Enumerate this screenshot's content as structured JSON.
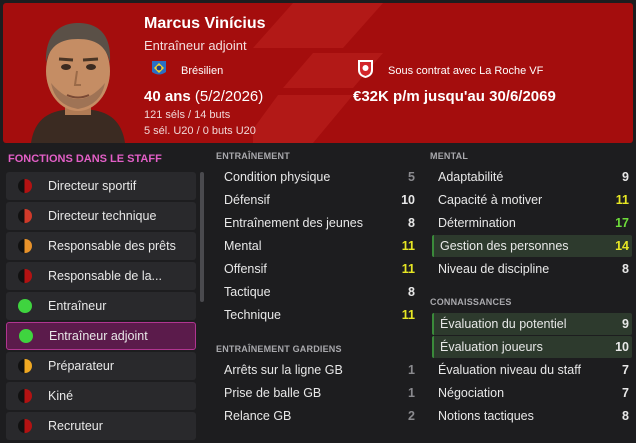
{
  "person": {
    "name": "Marcus Vinícius",
    "role": "Entraîneur adjoint",
    "nationality": "Brésilien",
    "age": "40 ans",
    "dob": "(5/2/2026)",
    "caps": "121 séls / 14 buts",
    "u20": "5 sél. U20 / 0 buts U20",
    "club": "Sous contrat avec La Roche VF",
    "contract": "€32K p/m jusqu'au 30/6/2069"
  },
  "colors": {
    "header": "#a40d0d",
    "roles_title": "#e35fc7",
    "active_role": "#5b1b4b",
    "highlight_row": "#2d3a2d"
  },
  "staff_roles": {
    "title": "FONCTIONS DANS LE STAFF",
    "items": [
      {
        "label": "Directeur sportif",
        "color": "#b31212",
        "half": true
      },
      {
        "label": "Directeur technique",
        "color": "#d03a2a",
        "half": true
      },
      {
        "label": "Responsable des prêts",
        "color": "#e8922a",
        "half": true
      },
      {
        "label": "Responsable de la...",
        "color": "#b31212",
        "half": true
      },
      {
        "label": "Entraîneur",
        "color": "#3fd43f",
        "half": false
      },
      {
        "label": "Entraîneur adjoint",
        "color": "#3fd43f",
        "half": false,
        "active": true
      },
      {
        "label": "Préparateur",
        "color": "#f0a822",
        "half": true
      },
      {
        "label": "Kiné",
        "color": "#b31212",
        "half": true
      },
      {
        "label": "Recruteur",
        "color": "#b31212",
        "half": true
      }
    ]
  },
  "training": {
    "title": "ENTRAÎNEMENT",
    "rows": [
      {
        "name": "Condition physique",
        "value": "5",
        "level": "low"
      },
      {
        "name": "Défensif",
        "value": "10",
        "level": "mid"
      },
      {
        "name": "Entraînement des jeunes",
        "value": "8",
        "level": "mid"
      },
      {
        "name": "Mental",
        "value": "11",
        "level": "yel"
      },
      {
        "name": "Offensif",
        "value": "11",
        "level": "yel"
      },
      {
        "name": "Tactique",
        "value": "8",
        "level": "mid"
      },
      {
        "name": "Technique",
        "value": "11",
        "level": "yel"
      }
    ]
  },
  "goalkeeping": {
    "title": "ENTRAÎNEMENT GARDIENS",
    "rows": [
      {
        "name": "Arrêts sur la ligne GB",
        "value": "1",
        "level": "low"
      },
      {
        "name": "Prise de balle GB",
        "value": "1",
        "level": "low"
      },
      {
        "name": "Relance GB",
        "value": "2",
        "level": "low"
      }
    ]
  },
  "mental": {
    "title": "MENTAL",
    "rows": [
      {
        "name": "Adaptabilité",
        "value": "9",
        "level": "mid"
      },
      {
        "name": "Capacité à motiver",
        "value": "11",
        "level": "yel"
      },
      {
        "name": "Détermination",
        "value": "17",
        "level": "grn"
      },
      {
        "name": "Gestion des personnes",
        "value": "14",
        "level": "yel",
        "highlight": true
      },
      {
        "name": "Niveau de discipline",
        "value": "8",
        "level": "mid"
      }
    ]
  },
  "knowledge": {
    "title": "CONNAISSANCES",
    "rows": [
      {
        "name": "Évaluation du potentiel",
        "value": "9",
        "level": "mid",
        "highlight": true
      },
      {
        "name": "Évaluation joueurs",
        "value": "10",
        "level": "mid",
        "highlight": true
      },
      {
        "name": "Évaluation niveau du staff",
        "value": "7",
        "level": "mid"
      },
      {
        "name": "Négociation",
        "value": "7",
        "level": "mid"
      },
      {
        "name": "Notions tactiques",
        "value": "8",
        "level": "mid"
      }
    ]
  }
}
